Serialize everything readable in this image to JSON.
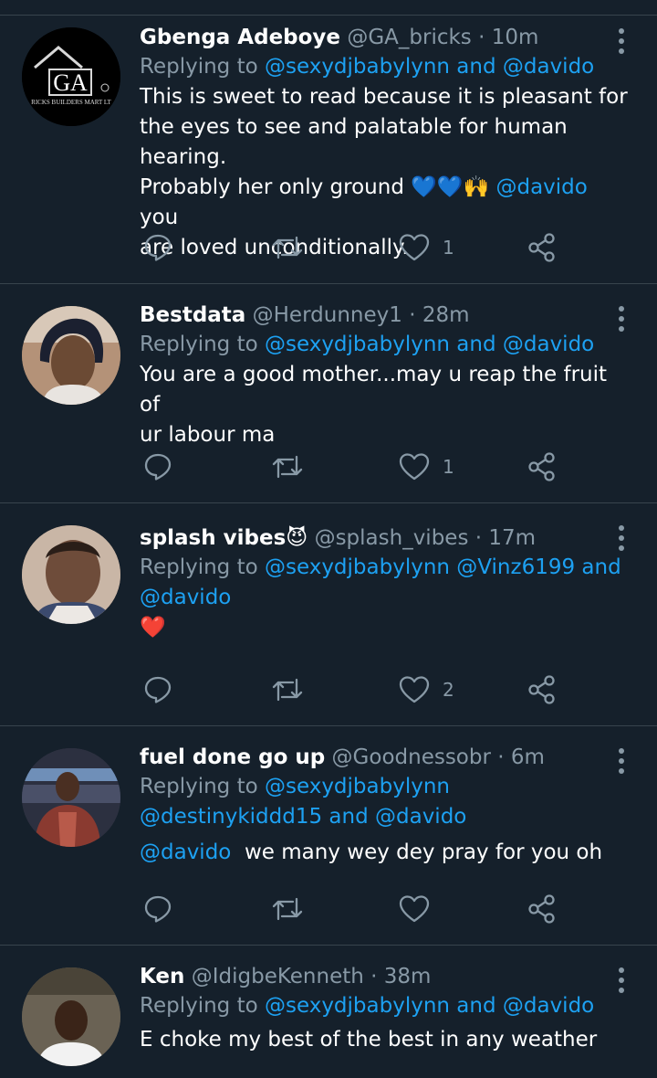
{
  "tweets": [
    {
      "name": "Gbenga Adeboye",
      "handle": "@GA_bricks",
      "dot": "·",
      "time": "10m",
      "replying_prefix": "Replying to",
      "replying_mentions": "@sexydjbabylynn and @davido",
      "body_lines": [
        "This is sweet to read because it is pleasant for",
        "the eyes to see and palatable for human hearing.",
        "Probably her only ground"
      ],
      "body_emoji": "💙💙🙌",
      "body_mention": "@davido",
      "body_tail": " you",
      "body_last": "are loved unconditionally.",
      "like_count": "1",
      "avatar_logo_text": "GA",
      "avatar_logo_sub": "RICKS BUILDERS MART LT"
    },
    {
      "name": "Bestdata",
      "handle": "@Herdunney1",
      "dot": "·",
      "time": "28m",
      "replying_prefix": "Replying to",
      "replying_mentions": "@sexydjbabylynn and @davido",
      "body_lines": [
        "You are a good mother...may u reap the fruit of",
        "ur labour ma"
      ],
      "like_count": "1"
    },
    {
      "name": "splash vibes",
      "name_emoji": "😈",
      "handle": "@splash_vibes",
      "dot": "·",
      "time": "17m",
      "replying_prefix": "Replying to",
      "replying_mentions_1": "@sexydjbabylynn @Vinz6199 and",
      "replying_mentions_2": "@davido",
      "body_emoji": "❤️",
      "like_count": "2"
    },
    {
      "name": "fuel done go up",
      "handle": "@Goodnessobr",
      "dot": "·",
      "time": "6m",
      "replying_prefix": "Replying to",
      "replying_mentions_1": "@sexydjbabylynn",
      "replying_mentions_2": "@destinykiddd15 and @davido",
      "body_mention": "@davido",
      "body_text": "  we many wey dey pray for you oh",
      "like_count": ""
    },
    {
      "name": "Ken",
      "handle": "@IdigbeKenneth",
      "dot": "·",
      "time": "38m",
      "replying_prefix": "Replying to",
      "replying_mentions": "@sexydjbabylynn and @davido",
      "body_lines": [
        "E choke my best of the best in any weather"
      ]
    }
  ],
  "colors": {
    "background": "#15202b",
    "divider": "#38444d",
    "secondary_text": "#8899a6",
    "mention": "#1da1f2"
  },
  "icons": [
    "reply-icon",
    "retweet-icon",
    "like-icon",
    "share-icon",
    "more-options-icon"
  ]
}
